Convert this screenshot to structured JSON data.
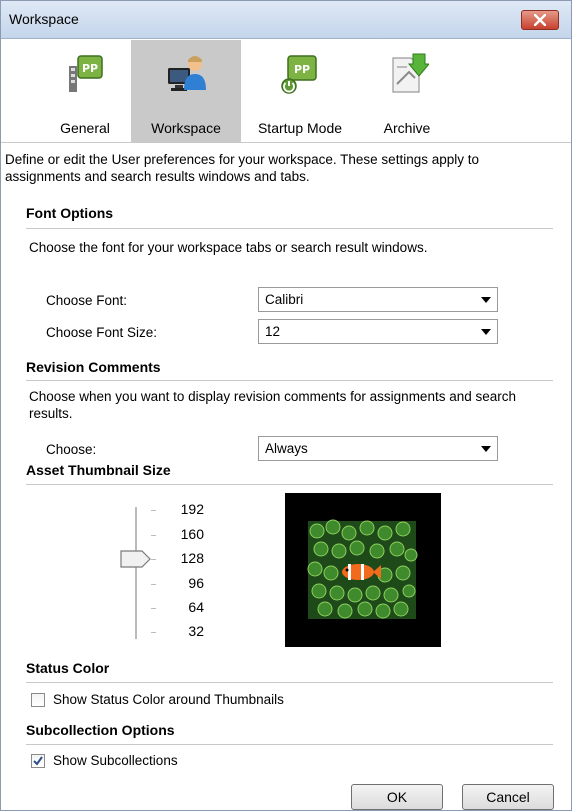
{
  "window": {
    "title": "Workspace"
  },
  "tabs": [
    {
      "label": "General",
      "icon": "general-settings-icon"
    },
    {
      "label": "Workspace",
      "icon": "workspace-user-icon"
    },
    {
      "label": "Startup Mode",
      "icon": "startup-mode-icon"
    },
    {
      "label": "Archive",
      "icon": "archive-icon"
    }
  ],
  "description": "Define or edit the User preferences for your workspace. These settings apply to assignments and search results windows and tabs.",
  "font_options": {
    "title": "Font Options",
    "description": "Choose the font for your workspace tabs or search result windows.",
    "font_label": "Choose Font:",
    "font_value": "Calibri",
    "size_label": "Choose Font Size:",
    "size_value": "12"
  },
  "revision_comments": {
    "title": "Revision Comments",
    "description": "Choose when you want to display revision comments for assignments and search results.",
    "choose_label": "Choose:",
    "choose_value": "Always"
  },
  "thumbnail_size": {
    "title": "Asset Thumbnail Size",
    "ticks": [
      "192",
      "160",
      "128",
      "96",
      "64",
      "32"
    ],
    "selected": "128"
  },
  "status_color": {
    "title": "Status Color",
    "checkbox_label": "Show Status Color around Thumbnails",
    "checked": false
  },
  "subcollection": {
    "title": "Subcollection Options",
    "checkbox_label": "Show Subcollections",
    "checked": true
  },
  "buttons": {
    "ok": "OK",
    "cancel": "Cancel"
  },
  "colors": {
    "active_tab": "#c9c9c9",
    "close_button": "#c7422e",
    "titlebar": "#cfdcee"
  }
}
